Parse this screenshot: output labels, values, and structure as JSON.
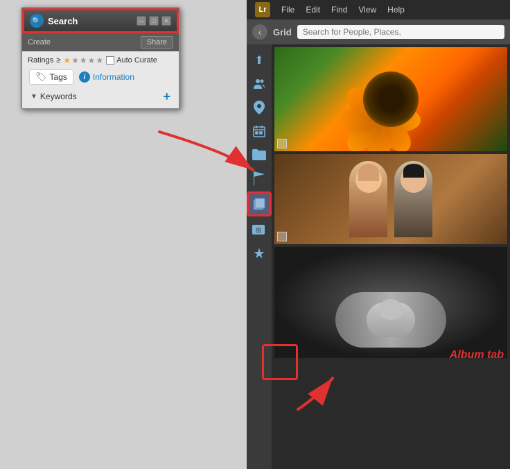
{
  "searchWindow": {
    "title": "Search",
    "controls": {
      "minimize": "—",
      "restore": "□",
      "close": "✕"
    },
    "toolbar": {
      "createLabel": "Create",
      "shareLabel": "Share"
    },
    "filters": {
      "ratingsLabel": "Ratings",
      "ratingsOp": "≥",
      "autoCurateLabel": "Auto Curate",
      "tagsLabel": "Tags",
      "infoLabel": "Information",
      "keywordsLabel": "Keywords",
      "addIcon": "+"
    }
  },
  "appPanel": {
    "menuItems": [
      "File",
      "Edit",
      "Find",
      "View",
      "Help"
    ],
    "header": {
      "backLabel": "‹",
      "gridLabel": "Grid",
      "searchPlaceholder": "Search for People, Places,"
    },
    "sidebarIcons": [
      {
        "name": "import-icon",
        "symbol": "⬆",
        "active": false
      },
      {
        "name": "people-icon",
        "symbol": "👥",
        "active": false
      },
      {
        "name": "location-icon",
        "symbol": "📍",
        "active": false
      },
      {
        "name": "calendar-icon",
        "symbol": "📅",
        "active": false
      },
      {
        "name": "folder-icon",
        "symbol": "📁",
        "active": false
      },
      {
        "name": "flag-icon",
        "symbol": "⚑",
        "active": false
      },
      {
        "name": "album-icon",
        "symbol": "▣",
        "highlighted": true
      },
      {
        "name": "smart-album-icon",
        "symbol": "⊞",
        "active": false
      },
      {
        "name": "star-icon",
        "symbol": "★",
        "active": false
      }
    ],
    "photos": [
      {
        "type": "flower",
        "description": "Orange flower close-up"
      },
      {
        "type": "portrait",
        "description": "Two women portrait"
      },
      {
        "type": "baby",
        "description": "Baby in black and white"
      }
    ],
    "albumTabLabel": "Album tab"
  }
}
